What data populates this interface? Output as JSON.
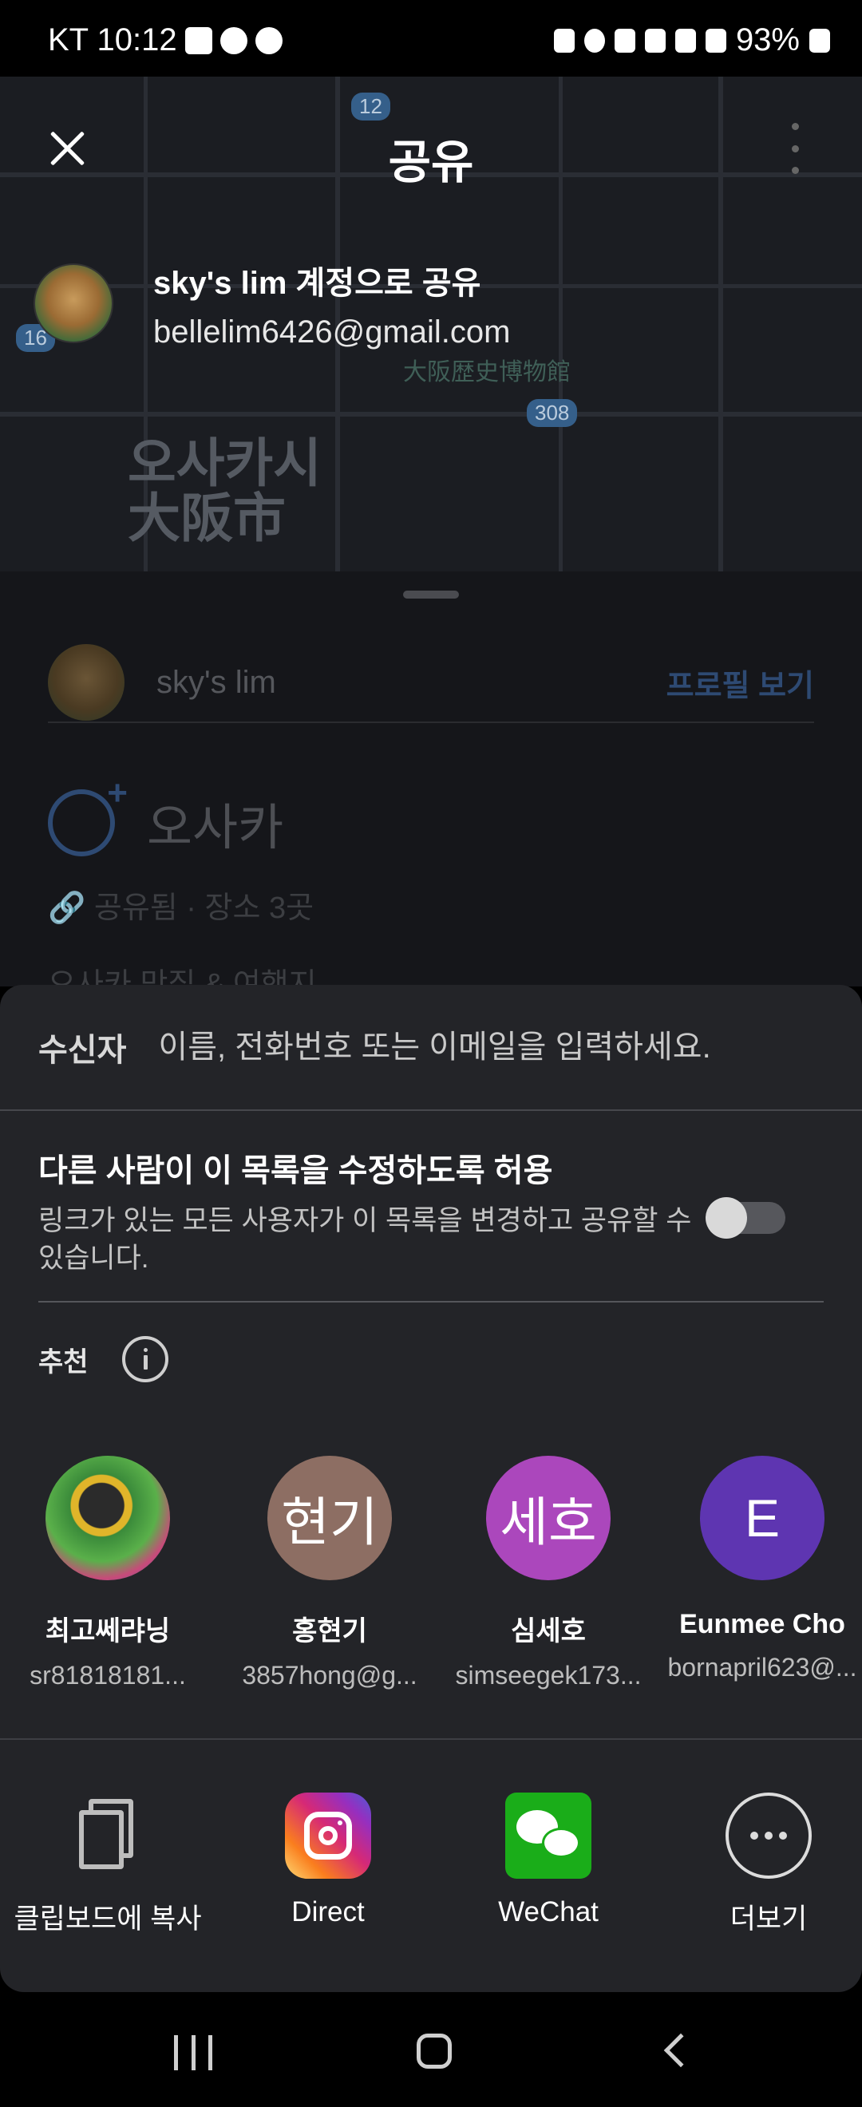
{
  "status_bar": {
    "carrier_time": "KT 10:12",
    "battery": "93%"
  },
  "map": {
    "city_label": "오사카시\n大阪市",
    "poi_label": "大阪歴史博物館",
    "route_12": "12",
    "route_16": "16",
    "route_308": "308"
  },
  "header": {
    "title": "공유"
  },
  "account": {
    "name": "sky's lim 계정으로 공유",
    "email": "bellelim6426@gmail.com"
  },
  "underlying": {
    "profile_name": "sky's lim",
    "profile_link": "프로필 보기",
    "list_title": "오사카",
    "list_meta": "🔗 공유됨 · 장소 3곳",
    "peek_text": "오사카 맛집 & 여행지"
  },
  "share": {
    "to_label": "수신자",
    "to_placeholder": "이름, 전화번호 또는 이메일을 입력하세요.",
    "perm_title": "다른 사람이 이 목록을 수정하도록 허용",
    "perm_desc": "링크가 있는 모든 사용자가 이 목록을 변경하고 공유할 수 있습니다.",
    "perm_enabled": false,
    "rec_label": "추천",
    "contacts": [
      {
        "initial": "",
        "name": "최고쎄랴닝",
        "sub": "sr81818181...",
        "color": "#3a8a3a"
      },
      {
        "initial": "현기",
        "name": "홍현기",
        "sub": "3857hong@g...",
        "color": "#8d6e63"
      },
      {
        "initial": "세호",
        "name": "심세호",
        "sub": "simseegek173...",
        "color": "#ab47bc"
      },
      {
        "initial": "E",
        "name": "Eunmee Cho",
        "sub": "bornapril623@...",
        "color": "#5e35b1"
      }
    ],
    "actions": [
      {
        "label": "클립보드에 복사",
        "icon": "copy-icon"
      },
      {
        "label": "Direct",
        "icon": "instagram-icon"
      },
      {
        "label": "WeChat",
        "icon": "wechat-icon"
      },
      {
        "label": "더보기",
        "icon": "more-icon"
      }
    ]
  }
}
